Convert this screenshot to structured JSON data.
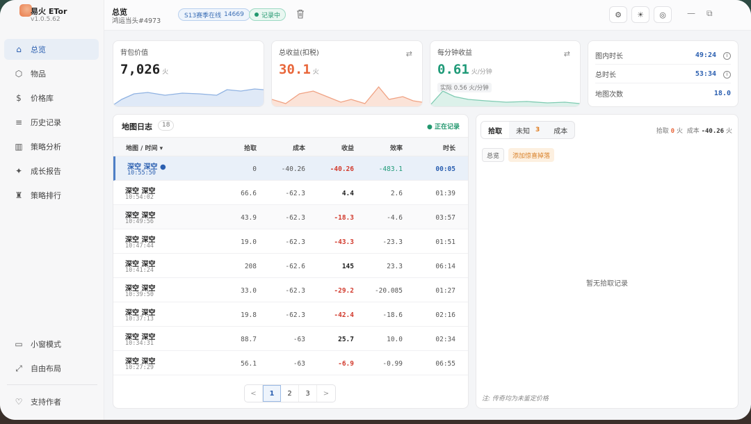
{
  "brand": {
    "name": "易火 ETor",
    "version": "v1.0.5.62"
  },
  "nav": [
    {
      "label": "总览",
      "icon": "home-icon",
      "active": true
    },
    {
      "label": "物品",
      "icon": "cube-icon"
    },
    {
      "label": "价格库",
      "icon": "dollar-icon"
    },
    {
      "label": "历史记录",
      "icon": "database-icon"
    },
    {
      "label": "策略分析",
      "icon": "bar-chart-icon"
    },
    {
      "label": "成长报告",
      "icon": "sparkle-icon"
    },
    {
      "label": "策略排行",
      "icon": "trophy-icon"
    }
  ],
  "nav_bottom": [
    {
      "label": "小窗模式",
      "icon": "window-icon"
    },
    {
      "label": "自由布局",
      "icon": "expand-icon"
    }
  ],
  "support": {
    "label": "支持作者",
    "icon": "heart-icon"
  },
  "header": {
    "title": "总览",
    "subtitle": "鸿运当头#4973",
    "season_label": "S13赛季在线",
    "season_count": "14669",
    "record_label": "记录中"
  },
  "stats": {
    "bag": {
      "label": "背包价值",
      "value": "7,026",
      "unit": "火"
    },
    "income": {
      "label": "总收益(扣税)",
      "value": "30.1",
      "unit": "火"
    },
    "per_min": {
      "label": "每分钟收益",
      "value": "0.61",
      "unit": "火/分钟",
      "actual": "实际 0.56 火/分钟"
    },
    "side": [
      {
        "label": "图内时长",
        "value": "49:24"
      },
      {
        "label": "总时长",
        "value": "53:34"
      },
      {
        "label": "地图次数",
        "value": "18.0"
      }
    ]
  },
  "map_log": {
    "title": "地图日志",
    "count": "18",
    "status": "● 正在记录",
    "columns": [
      "地图 / 时间 ▾",
      "拾取",
      "成本",
      "收益",
      "效率",
      "时长"
    ],
    "rows": [
      {
        "name": "深空 深空 ●",
        "time": "10:55:50",
        "pickup": "0",
        "cost": "-40.26",
        "income": "-40.26",
        "eff": "-483.1",
        "dur": "00:05"
      },
      {
        "name": "深空 深空",
        "time": "10:54:02",
        "pickup": "66.6",
        "cost": "-62.3",
        "income": "4.4",
        "eff": "2.6",
        "dur": "01:39"
      },
      {
        "name": "深空 深空",
        "time": "10:49:56",
        "pickup": "43.9",
        "cost": "-62.3",
        "income": "-18.3",
        "eff": "-4.6",
        "dur": "03:57"
      },
      {
        "name": "深空 深空",
        "time": "10:47:44",
        "pickup": "19.0",
        "cost": "-62.3",
        "income": "-43.3",
        "eff": "-23.3",
        "dur": "01:51"
      },
      {
        "name": "深空 深空",
        "time": "10:41:24",
        "pickup": "208",
        "cost": "-62.6",
        "income": "145",
        "eff": "23.3",
        "dur": "06:14"
      },
      {
        "name": "深空 深空",
        "time": "10:39:50",
        "pickup": "33.0",
        "cost": "-62.3",
        "income": "-29.2",
        "eff": "-20.085",
        "dur": "01:27"
      },
      {
        "name": "深空 深空",
        "time": "10:37:13",
        "pickup": "19.8",
        "cost": "-62.3",
        "income": "-42.4",
        "eff": "-18.6",
        "dur": "02:16"
      },
      {
        "name": "深空 深空",
        "time": "10:34:31",
        "pickup": "88.7",
        "cost": "-63",
        "income": "25.7",
        "eff": "10.0",
        "dur": "02:34"
      },
      {
        "name": "深空 深空",
        "time": "10:27:29",
        "pickup": "56.1",
        "cost": "-63",
        "income": "-6.9",
        "eff": "-0.99",
        "dur": "06:55"
      }
    ],
    "pages": [
      "1",
      "2",
      "3"
    ],
    "prev": "<",
    "next": ">"
  },
  "right_panel": {
    "tabs": [
      "拾取",
      "未知",
      "成本"
    ],
    "unknown_badge": "3",
    "summary_pickup_label": "拾取",
    "summary_pickup": "0",
    "summary_pickup_unit": "火",
    "summary_cost_label": "成本",
    "summary_cost": "-40.26",
    "summary_cost_unit": "火",
    "chip_all": "总览",
    "chip_add": "添加惊喜掉落",
    "empty": "暂无拾取记录",
    "note": "注: 传奇均为未鉴定价格"
  },
  "colors": {
    "accent": "#2b5fb0",
    "positive": "#22976e",
    "negative": "#d23b2e",
    "income": "#e8663a"
  }
}
